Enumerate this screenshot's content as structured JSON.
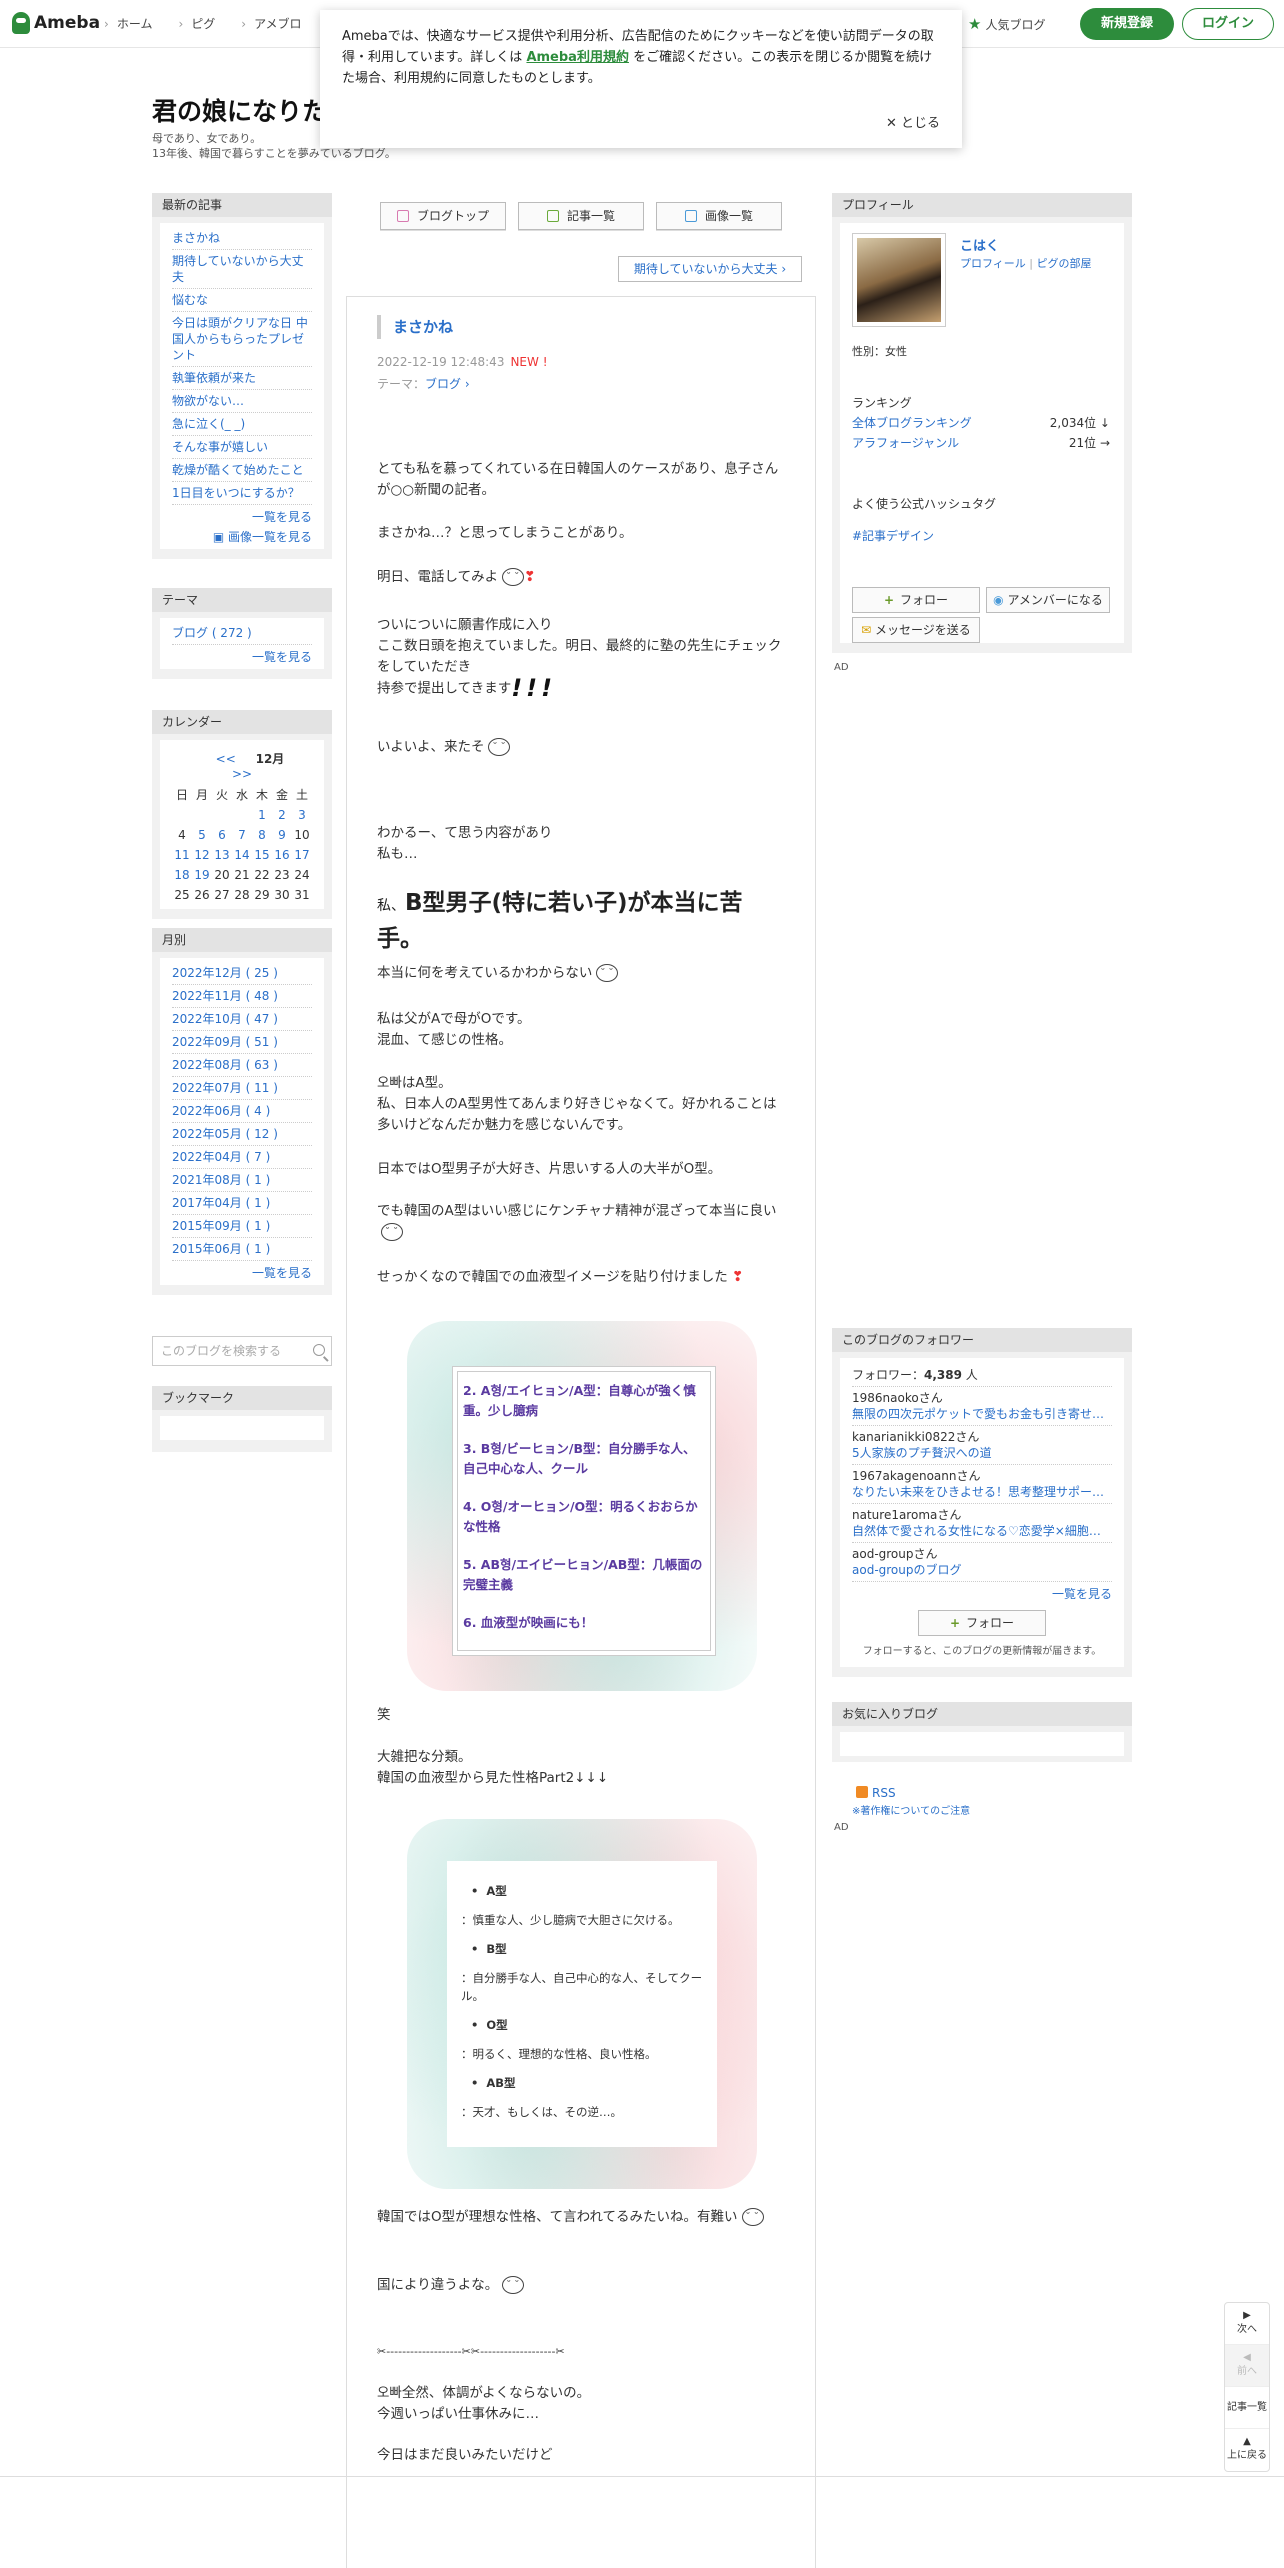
{
  "header": {
    "logo": "Ameba",
    "nav": [
      "ホーム",
      "ピグ",
      "アメブロ"
    ],
    "popular": "人気ブログ",
    "register": "新規登録",
    "login": "ログイン"
  },
  "cookie": {
    "text_before": "Amebaでは、快適なサービス提供や利用分析、広告配信のためにクッキーなどを使い訪問データの取得・利用しています。詳しくは",
    "terms_link": "Ameba利用規約",
    "text_after": "をご確認ください。この表示を閉じるか閲覧を続けた場合、利用規約に同意したものとします。",
    "close": "とじる"
  },
  "blog": {
    "title": "君の娘になりた",
    "desc1": "母であり、女であり。",
    "desc2": "13年後、韓国で暮らすことを夢みているブログ。"
  },
  "left": {
    "recent_head": "最新の記事",
    "recent": [
      "まさかね",
      "期待していないから大丈夫",
      "悩むな",
      "今日は頭がクリアな日 中国人からもらったプレゼント",
      "執筆依頼が来た",
      "物欲がない…",
      "急に泣く(_ _)",
      "そんな事が嬉しい",
      "乾燥が酷くて始めたこと",
      "1日目をいつにするか？"
    ],
    "more_list": "一覧を見る",
    "more_images": "画像一覧を見る",
    "theme_head": "テーマ",
    "theme_item": "ブログ ( 272 )",
    "theme_more": "一覧を見る",
    "cal_head": "カレンダー",
    "cal_prev": "<<",
    "cal_month": "12月",
    "cal_next": ">>",
    "cal_days": [
      "日",
      "月",
      "火",
      "水",
      "木",
      "金",
      "土"
    ],
    "cal_cells": [
      "",
      "",
      "",
      "",
      "1",
      "2",
      "3",
      "4",
      "5",
      "6",
      "7",
      "8",
      "9",
      "10",
      "11",
      "12",
      "13",
      "14",
      "15",
      "16",
      "17",
      "18",
      "19",
      "20",
      "21",
      "22",
      "23",
      "24",
      "25",
      "26",
      "27",
      "28",
      "29",
      "30",
      "31"
    ],
    "cal_linked": [
      "1",
      "2",
      "3",
      "5",
      "6",
      "7",
      "8",
      "9",
      "11",
      "12",
      "13",
      "14",
      "15",
      "16",
      "17",
      "18",
      "19"
    ],
    "month_head": "月別",
    "months": [
      "2022年12月 ( 25 )",
      "2022年11月 ( 48 )",
      "2022年10月 ( 47 )",
      "2022年09月 ( 51 )",
      "2022年08月 ( 63 )",
      "2022年07月 ( 11 )",
      "2022年06月 ( 4 )",
      "2022年05月 ( 12 )",
      "2022年04月 ( 7 )",
      "2021年08月 ( 1 )",
      "2017年04月 ( 1 )",
      "2015年09月 ( 1 )",
      "2015年06月 ( 1 )"
    ],
    "month_more": "一覧を見る",
    "search_placeholder": "このブログを検索する",
    "bookmark_head": "ブックマーク"
  },
  "main": {
    "btn_top": "ブログトップ",
    "btn_list": "記事一覧",
    "btn_images": "画像一覧",
    "next_link": "期待していないから大丈夫 ›",
    "title": "まさかね",
    "date": "2022-12-19 12:48:43",
    "new": "NEW !",
    "theme_label": "テーマ：",
    "theme": "ブログ ›",
    "p1": "とても私を慕ってくれている在日韓国人のケースがあり、息子さんが○○新聞の記者。",
    "p2": "まさかね…？と思ってしまうことがあり。",
    "p3": "明日、電話してみよ",
    "p4a": "ついについに願書作成に入り",
    "p4b": "ここ数日頭を抱えていました。明日、最終的に塾の先生にチェックをしていただき",
    "p4c": "持参で提出してきます",
    "p5": "いよいよ、来たそ",
    "p6a": "わかるー、て思う内容があり",
    "p6b": "私も…",
    "h_small": "私、",
    "h_big": "B型男子(特に若い子)が本当に苦手。",
    "p7": "本当に何を考えているかわからない",
    "p8a": "私は父がAで母がOです。",
    "p8b": "混血、て感じの性格。",
    "p9a": "오빠はA型。",
    "p9b": "私、日本人のA型男性てあんまり好きじゃなくて。好かれることは多いけどなんだか魅力を感じないんです。",
    "p10": "日本ではO型男子が大好き、片思いする人の大半がO型。",
    "p11": "でも韓国のA型はいい感じにケンチャナ精神が混ざって本当に良い",
    "p12": "せっかくなので韓国での血液型イメージを貼り付けました",
    "img1": [
      "2. A형/エイヒョン/A型：自尊心が強く慎重。少し臆病",
      "3. B형/ビーヒョン/B型：自分勝手な人、自己中心な人、クール",
      "4. O형/オーヒョン/O型：明るくおおらかな性格",
      "5. AB형/エイビーヒョン/AB型：几帳面の完璧主義",
      "6. 血液型が映画にも！"
    ],
    "p13": "笑",
    "p14a": "大雑把な分類。",
    "p14b": "韓国の血液型から見た性格Part2↓↓↓",
    "img2": {
      "a": "A型",
      "a_d": "：慎重な人、少し臆病で大胆さに欠ける。",
      "b": "B型",
      "b_d": "：自分勝手な人、自己中心的な人、そしてクール。",
      "o": "O型",
      "o_d": "：明るく、理想的な性格、良い性格。",
      "ab": "AB型",
      "ab_d": "：天才、もしくは、その逆…。"
    },
    "p15": "韓国ではO型が理想な性格、て言われてるみたいね。有難い",
    "p16": "国により違うよな。",
    "divider": "✂-------------------✂✂-------------------✂",
    "p17a": "오빠全然、体調がよくならないの。",
    "p17b": "今週いっぱい仕事休みに…",
    "p18": "今日はまだ良いみたいだけど"
  },
  "right": {
    "profile_head": "プロフィール",
    "name": "こはく",
    "profile_link": "プロフィール",
    "pigg_link": "ピグの部屋",
    "gender": "性別：女性",
    "ranking_label": "ランキング",
    "rank1_label": "全体ブログランキング",
    "rank1_val": "2,034位 ↓",
    "rank2_label": "アラフォージャンル",
    "rank2_val": "21位 →",
    "hashtag_label": "よく使う公式ハッシュタグ",
    "hashtag": "#記事デザイン",
    "follow": "フォロー",
    "member": "アメンバーになる",
    "message": "メッセージを送る",
    "followers_head": "このブログのフォロワー",
    "follower_count_label": "フォロワー：",
    "follower_count": "4,389",
    "follower_unit": " 人",
    "followers": [
      {
        "name": "1986naokoさん",
        "blog": "無限の四次元ポケットで愛もお金も引き寄せ…"
      },
      {
        "name": "kanarianikki0822さん",
        "blog": "5人家族のプチ贅沢への道"
      },
      {
        "name": "1967akagenoannさん",
        "blog": "なりたい未来をひきよせる！思考整理サポー…"
      },
      {
        "name": "nature1aromaさん",
        "blog": "自然体で愛される女性になる♡恋愛学×細胞美…"
      },
      {
        "name": "aod-groupさん",
        "blog": "aod-groupのブログ"
      }
    ],
    "followers_more": "一覧を見る",
    "follow2": "フォロー",
    "follow_note": "フォローすると、このブログの更新情報が届きます。",
    "fav_head": "お気に入りブログ",
    "rss": "RSS",
    "copyright_note": "※著作権についてのご注意",
    "ad": "AD"
  },
  "floatnav": {
    "next": "次へ",
    "prev": "前へ",
    "list": "記事一覧",
    "top": "上に戻る"
  }
}
